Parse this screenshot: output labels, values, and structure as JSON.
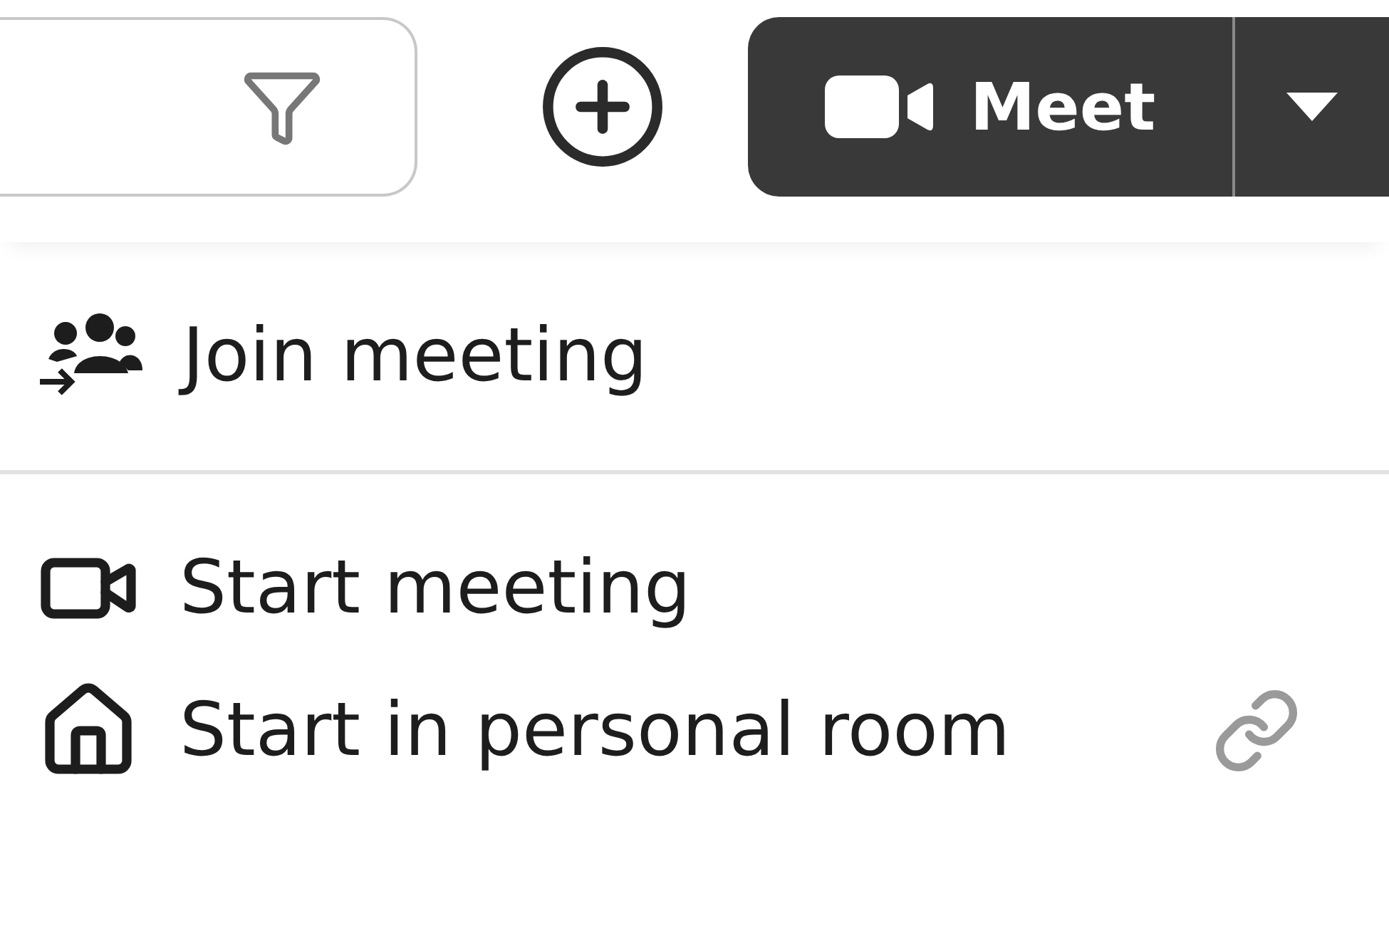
{
  "toolbar": {
    "meet_button": {
      "label": "Meet"
    }
  },
  "menu": {
    "sections": [
      [
        {
          "label": "Join meeting",
          "kind": "join"
        }
      ],
      [
        {
          "label": "Start meeting",
          "kind": "start"
        },
        {
          "label": "Start in personal room",
          "kind": "room"
        }
      ]
    ]
  }
}
